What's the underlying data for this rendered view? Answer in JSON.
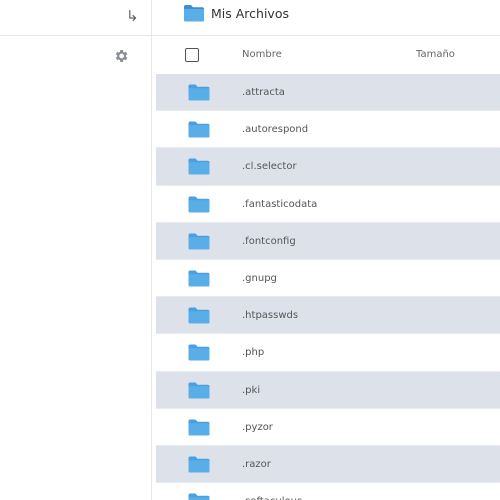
{
  "sidebar": {
    "arrow_icon": "↳",
    "settings_icon": "gear-icon"
  },
  "breadcrumb": {
    "title": "Mis Archivos"
  },
  "table": {
    "columns": {
      "name": "Nombre",
      "size": "Tamaño"
    },
    "rows": [
      {
        "name": ".attracta"
      },
      {
        "name": ".autorespond"
      },
      {
        "name": ".cl.selector"
      },
      {
        "name": ".fantasticodata"
      },
      {
        "name": ".fontconfig"
      },
      {
        "name": ".gnupg"
      },
      {
        "name": ".htpasswds"
      },
      {
        "name": ".php"
      },
      {
        "name": ".pki"
      },
      {
        "name": ".pyzor"
      },
      {
        "name": ".razor"
      },
      {
        "name": ".softaculous"
      }
    ]
  },
  "colors": {
    "folder": "#5aaee8",
    "row_shade": "#dde2ea"
  }
}
